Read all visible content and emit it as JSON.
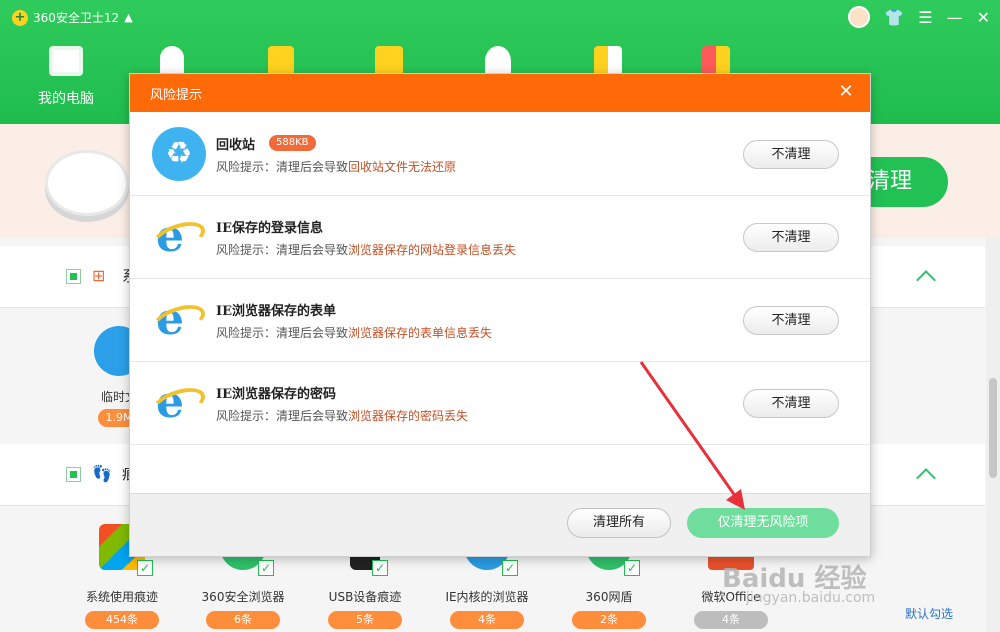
{
  "app": {
    "title": "360安全卫士12",
    "nav": [
      {
        "label": "我的电脑"
      }
    ],
    "scan_button_label": "清理",
    "sections": [
      {
        "label": "系"
      },
      {
        "label": "痕"
      }
    ],
    "temp_item": {
      "label": "临时文",
      "size": "1.9M"
    },
    "bottom_items": [
      {
        "label": "系统使用痕迹",
        "count": "454条"
      },
      {
        "label": "360安全浏览器",
        "count": "6条"
      },
      {
        "label": "USB设备痕迹",
        "count": "5条"
      },
      {
        "label": "IE内核的浏览器",
        "count": "4条"
      },
      {
        "label": "360网盾",
        "count": "2条"
      },
      {
        "label": "微软Office",
        "count": "4条"
      }
    ],
    "default_check_link": "默认勾选"
  },
  "dialog": {
    "title": "风险提示",
    "desc_prefix": "风险提示：清理后会导致",
    "items": [
      {
        "name": "回收站",
        "size": "588KB",
        "consequence": "回收站文件无法还原",
        "icon": "recycle-icon"
      },
      {
        "name": "IE保存的登录信息",
        "consequence": "浏览器保存的网站登录信息丢失",
        "icon": "ie-icon"
      },
      {
        "name": "IE浏览器保存的表单",
        "consequence": "浏览器保存的表单信息丢失",
        "icon": "ie-icon"
      },
      {
        "name": "IE浏览器保存的密码",
        "consequence": "浏览器保存的密码丢失",
        "icon": "ie-icon"
      }
    ],
    "no_clean_label": "不清理",
    "clean_all_label": "清理所有",
    "clean_safe_only_label": "仅清理无风险项"
  },
  "watermark": {
    "brand": "Baidu 经验",
    "url": "jingyan.baidu.com"
  },
  "colors": {
    "brand_green": "#22c154",
    "dialog_orange": "#ff6a08",
    "highlight": "#c14f25",
    "safe_button": "#6fdd9c",
    "annotation_arrow": "#e8303a"
  }
}
